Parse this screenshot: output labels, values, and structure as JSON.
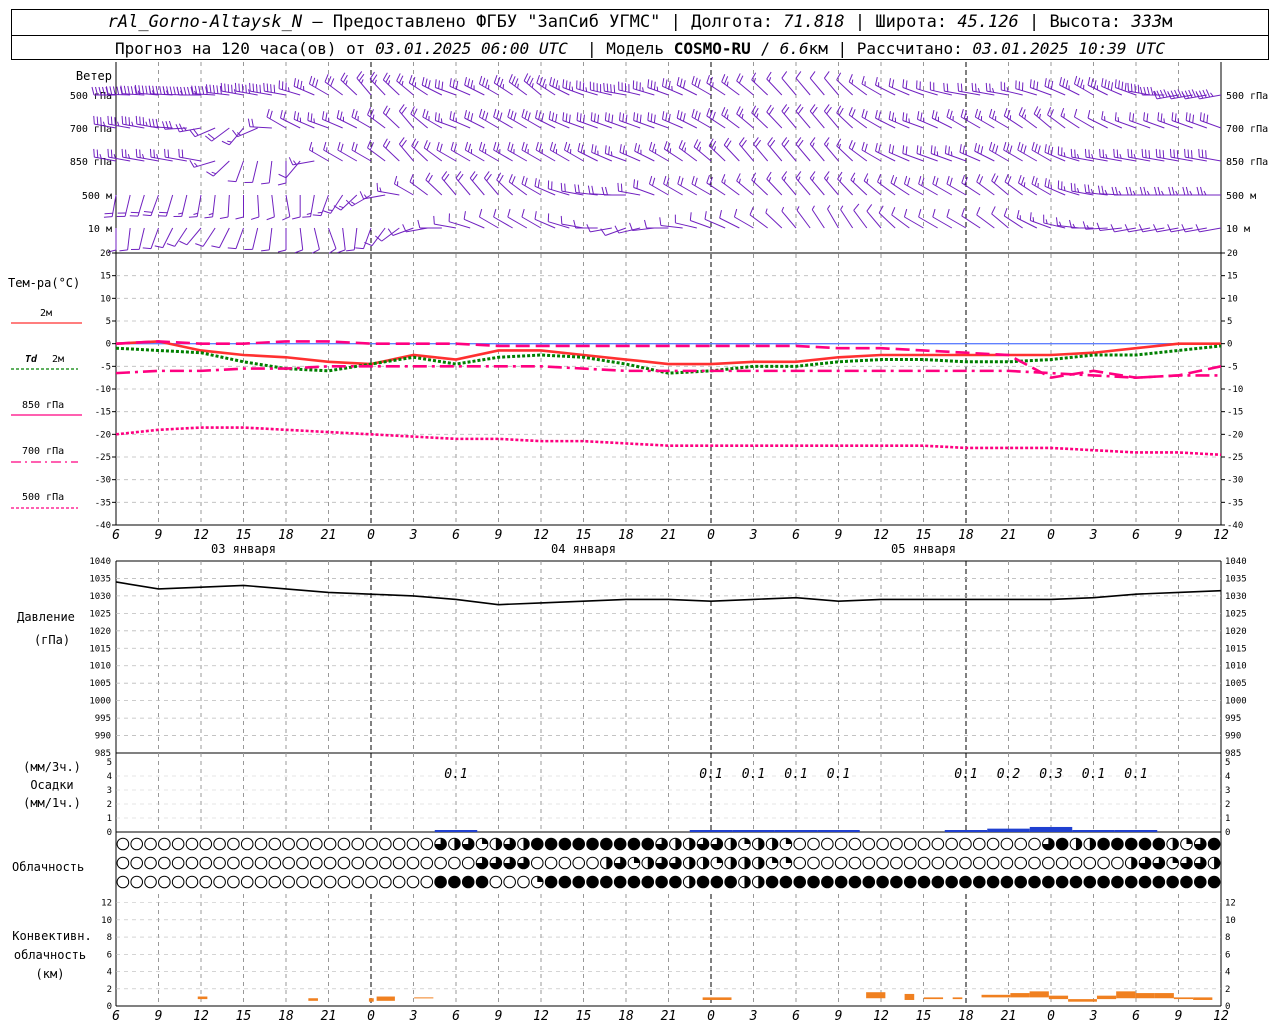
{
  "header": {
    "station": "rAl_Gorno-Altaysk_N",
    "dash": "–",
    "provider": "Предоставлено ФГБУ \"ЗапСиб УГМС\"",
    "lon_label": "Долгота:",
    "lon_value": "71.818",
    "lat_label": "Широта:",
    "lat_value": "45.126",
    "alt_label": "Высота:",
    "alt_value": "333",
    "alt_unit": "м",
    "forecast_prefix": "Прогноз на 120 часа(ов) от",
    "forecast_time": "03.01.2025 06:00 UTC",
    "model_label": "Модель",
    "model_name": "COSMO-RU",
    "model_res": "6.6",
    "model_unit": "км",
    "calc_label": "Рассчитано:",
    "calc_time": "03.01.2025 10:39 UTC",
    "sep": "|"
  },
  "chart_data": [
    {
      "type": "wind-barbs",
      "title": "Ветер",
      "levels": [
        "500 гПа",
        "700 гПа",
        "850 гПа",
        "500 м",
        "10 м"
      ],
      "x_hours": [
        6,
        9,
        12,
        15,
        18,
        21,
        0,
        3,
        6,
        9,
        12,
        15,
        18,
        21,
        0,
        3,
        6,
        9,
        12,
        15,
        18,
        21,
        0,
        3,
        6,
        9,
        12
      ],
      "direction_deg": {
        "500 гПа": [
          270,
          275,
          270,
          280,
          280,
          300,
          320,
          310,
          290,
          300,
          310,
          290,
          280,
          290,
          300,
          310,
          320,
          320,
          300,
          290,
          280,
          280,
          290,
          300,
          290,
          260,
          260
        ],
        "700 гПа": [
          280,
          280,
          260,
          220,
          300,
          290,
          300,
          320,
          290,
          300,
          300,
          290,
          290,
          290,
          300,
          310,
          320,
          320,
          300,
          290,
          300,
          300,
          310,
          300,
          290,
          290,
          290
        ],
        "850 гПа": [
          280,
          280,
          280,
          200,
          180,
          300,
          300,
          320,
          300,
          300,
          300,
          300,
          290,
          300,
          310,
          320,
          320,
          320,
          300,
          290,
          290,
          300,
          300,
          280,
          280,
          280,
          280
        ],
        "500 м": [
          190,
          200,
          190,
          180,
          170,
          200,
          240,
          300,
          320,
          320,
          300,
          280,
          270,
          300,
          300,
          310,
          320,
          320,
          310,
          300,
          300,
          310,
          300,
          280,
          270,
          270,
          270
        ],
        "10 м": [
          180,
          200,
          220,
          200,
          180,
          160,
          200,
          250,
          280,
          300,
          300,
          280,
          250,
          270,
          290,
          300,
          320,
          330,
          320,
          300,
          300,
          310,
          290,
          270,
          260,
          260,
          260
        ]
      },
      "speed_ms": {
        "500 гПа": [
          20,
          22,
          22,
          18,
          16,
          12,
          10,
          10,
          12,
          14,
          14,
          14,
          16,
          14,
          12,
          8,
          4,
          4,
          6,
          8,
          8,
          10,
          12,
          14,
          16,
          18,
          18
        ],
        "700 гПа": [
          14,
          14,
          10,
          6,
          8,
          10,
          10,
          8,
          10,
          12,
          12,
          12,
          12,
          12,
          12,
          10,
          8,
          8,
          8,
          10,
          10,
          10,
          10,
          4,
          6,
          10,
          12
        ],
        "850 гПа": [
          10,
          10,
          8,
          4,
          4,
          6,
          8,
          8,
          8,
          10,
          10,
          10,
          10,
          10,
          10,
          8,
          8,
          6,
          8,
          8,
          10,
          12,
          12,
          10,
          10,
          12,
          12
        ],
        "500 м": [
          8,
          8,
          6,
          4,
          4,
          6,
          6,
          6,
          8,
          8,
          8,
          8,
          8,
          8,
          8,
          6,
          6,
          6,
          6,
          8,
          8,
          8,
          10,
          10,
          10,
          10,
          10
        ],
        "10 м": [
          4,
          4,
          4,
          4,
          4,
          4,
          4,
          4,
          4,
          4,
          4,
          4,
          4,
          4,
          4,
          4,
          2,
          2,
          4,
          4,
          4,
          4,
          6,
          6,
          4,
          4,
          4
        ]
      }
    },
    {
      "type": "line",
      "title": "Тем-ра(°С)",
      "ylim": [
        -40,
        20
      ],
      "ytick_step": 5,
      "x_hours": [
        6,
        9,
        12,
        15,
        18,
        21,
        0,
        3,
        6,
        9,
        12,
        15,
        18,
        21,
        0,
        3,
        6,
        9,
        12,
        15,
        18,
        21,
        0,
        3,
        6,
        9,
        12
      ],
      "series": [
        {
          "name": "2м",
          "color": "#ff3030",
          "style": "solid",
          "values": [
            0,
            0.5,
            -1.5,
            -2.5,
            -3,
            -4,
            -4.5,
            -2.5,
            -3.5,
            -1.5,
            -1.5,
            -2.5,
            -3.5,
            -4.5,
            -4.5,
            -4,
            -4,
            -3,
            -2.5,
            -2.5,
            -2.5,
            -2.5,
            -2.5,
            -2,
            -1,
            0,
            0
          ]
        },
        {
          "name": "Td 2м",
          "color": "#008000",
          "style": "dotted",
          "values": [
            -1,
            -1.5,
            -2,
            -4,
            -5.5,
            -6,
            -4.5,
            -3,
            -4.5,
            -3,
            -2.5,
            -3,
            -4.5,
            -6.5,
            -6,
            -5,
            -5,
            -4,
            -3.5,
            -3.5,
            -4,
            -4,
            -3.5,
            -2.5,
            -2.5,
            -1.5,
            -0.5
          ]
        },
        {
          "name": "850 гПа",
          "color": "#ff0080",
          "style": "longdash",
          "values": [
            0,
            0.5,
            0,
            0,
            0.5,
            0.5,
            0,
            0,
            0,
            -0.5,
            -0.5,
            -0.5,
            -0.5,
            -0.5,
            -0.5,
            -0.5,
            -0.5,
            -1,
            -1,
            -1.5,
            -2,
            -2.5,
            -7.5,
            -6,
            -7.5,
            -7,
            -5
          ]
        },
        {
          "name": "700 гПа",
          "color": "#ff0080",
          "style": "dashdot",
          "values": [
            -6.5,
            -6,
            -6,
            -5.5,
            -5.5,
            -5,
            -5,
            -5,
            -5,
            -5,
            -5,
            -5.5,
            -6,
            -6,
            -6,
            -6,
            -6,
            -6,
            -6,
            -6,
            -6,
            -6,
            -6.5,
            -7,
            -7.5,
            -7,
            -7
          ]
        },
        {
          "name": "500 гПа",
          "color": "#ff0080",
          "style": "shortdash",
          "values": [
            -20,
            -19,
            -18.5,
            -18.5,
            -19,
            -19.5,
            -20,
            -20.5,
            -21,
            -21,
            -21.5,
            -21.5,
            -22,
            -22.5,
            -22.5,
            -22.5,
            -22.5,
            -22.5,
            -22.5,
            -22.5,
            -23,
            -23,
            -23,
            -23.5,
            -24,
            -24,
            -24.5
          ]
        }
      ],
      "x_tick_labels": [
        "6",
        "9",
        "12",
        "15",
        "18",
        "21",
        "0",
        "3",
        "6",
        "9",
        "12",
        "15",
        "18",
        "21",
        "0",
        "3",
        "6",
        "9",
        "12",
        "15",
        "18",
        "21",
        "0",
        "3",
        "6",
        "9",
        "12"
      ],
      "day_labels": [
        "03 января",
        "04 января",
        "05 января"
      ]
    },
    {
      "type": "line",
      "title": "Давление",
      "ylabel": "(гПа)",
      "ylim": [
        985,
        1040
      ],
      "ytick_step": 5,
      "x_hours": [
        6,
        9,
        12,
        15,
        18,
        21,
        0,
        3,
        6,
        9,
        12,
        15,
        18,
        21,
        0,
        3,
        6,
        9,
        12,
        15,
        18,
        21,
        0,
        3,
        6,
        9,
        12
      ],
      "series": [
        {
          "color": "#000000",
          "values": [
            1034,
            1032,
            1032.5,
            1033,
            1032,
            1031,
            1030.5,
            1030,
            1029,
            1027.5,
            1028,
            1028.5,
            1029,
            1029,
            1028.5,
            1029,
            1029.5,
            1028.5,
            1029,
            1029,
            1029,
            1029,
            1029,
            1029.5,
            1030.5,
            1031,
            1031.5
          ]
        }
      ]
    },
    {
      "type": "bar",
      "title": "Осадки",
      "ylabel_top": "(мм/3ч.)",
      "ylabel_bottom": "(мм/1ч.)",
      "ylim": [
        0,
        5
      ],
      "ytick_step": 1,
      "x_hours": [
        6,
        9,
        12,
        15,
        18,
        21,
        0,
        3,
        6,
        9,
        12,
        15,
        18,
        21,
        0,
        3,
        6,
        9,
        12,
        15,
        18,
        21,
        0,
        3,
        6,
        9,
        12
      ],
      "values": [
        0,
        0,
        0,
        0,
        0,
        0,
        0,
        0,
        0.1,
        0,
        0,
        0,
        0,
        0,
        0.1,
        0.1,
        0.1,
        0.1,
        0,
        0,
        0.1,
        0.2,
        0.3,
        0.1,
        0.1,
        0,
        0
      ],
      "labels": [
        {
          "index": 8,
          "text": "0.1"
        },
        {
          "index": 14,
          "text": "0.1"
        },
        {
          "index": 15,
          "text": "0.1"
        },
        {
          "index": 16,
          "text": "0.1"
        },
        {
          "index": 17,
          "text": "0.1"
        },
        {
          "index": 20,
          "text": "0.1"
        },
        {
          "index": 21,
          "text": "0.2"
        },
        {
          "index": 22,
          "text": "0.3"
        },
        {
          "index": 23,
          "text": "0.1"
        },
        {
          "index": 24,
          "text": "0.1"
        }
      ],
      "color": "#2040d0"
    },
    {
      "type": "cloud-cover",
      "title": "Облачность",
      "layers": [
        "верхний",
        "средний",
        "нижний"
      ],
      "symbols_per_row": 80,
      "coverage_fraction": {
        "верхний": "0000000000000000000000000000000000000000000000000000011111111111111111111111111111",
        "средний": "0000000000000000000000000000000000000000000000000000011111111000000000000000001111",
        "нижний": "0000000000000000000000000000000000000000000000001111111111111111111111111111111111"
      },
      "detail": {
        "upper_values": [
          0,
          0,
          0,
          0,
          0,
          0,
          0,
          0,
          0,
          0,
          0,
          0,
          0,
          0,
          0,
          0,
          0,
          0,
          0,
          0,
          0,
          0,
          0,
          0.75,
          0.5,
          0.75,
          0.25,
          0.5,
          0.75,
          0.5,
          1,
          1,
          1,
          1,
          1,
          1,
          1,
          1,
          1,
          0.75,
          0.5,
          0.5,
          0.75,
          0.75,
          0.5,
          0.25,
          0.5,
          0.5,
          0.25,
          0,
          0,
          0,
          0,
          0,
          0,
          0,
          0,
          0,
          0,
          0,
          0,
          0,
          0,
          0,
          0,
          0,
          0,
          0.75,
          1,
          0.5,
          0.5,
          1,
          1,
          1,
          1,
          1,
          0.5,
          0.25,
          0.75,
          1,
          1,
          1,
          1,
          1
        ],
        "middle_values": [
          0,
          0,
          0,
          0,
          0,
          0,
          0,
          0,
          0,
          0,
          0,
          0,
          0,
          0,
          0,
          0,
          0,
          0,
          0,
          0,
          0,
          0,
          0,
          0,
          0,
          0,
          0.75,
          0.75,
          0.75,
          0.75,
          0,
          0,
          0,
          0,
          0,
          0.5,
          0.75,
          0.25,
          0.5,
          0.75,
          0.75,
          0.5,
          0.5,
          0.25,
          0.5,
          0.5,
          0.5,
          0.25,
          0.25,
          0,
          0,
          0,
          0,
          0,
          0,
          0,
          0,
          0,
          0,
          0,
          0,
          0,
          0,
          0,
          0,
          0,
          0,
          0,
          0,
          0,
          0,
          0,
          0,
          0.5,
          0.75,
          0.75,
          0.25,
          0.75,
          0.75,
          0.5,
          0.75,
          0.25,
          0,
          0
        ],
        "lower_values": [
          0,
          0,
          0,
          0,
          0,
          0,
          0,
          0,
          0,
          0,
          0,
          0,
          0,
          0,
          0,
          0,
          0,
          0,
          0,
          0,
          0,
          0,
          0,
          1,
          1,
          1,
          1,
          0,
          0,
          0,
          0.25,
          1,
          1,
          1,
          1,
          1,
          1,
          1,
          1,
          1,
          1,
          0.5,
          1,
          1,
          1,
          0.5,
          0.5,
          1,
          1,
          1,
          1,
          1,
          1,
          1,
          1,
          1,
          1,
          1,
          1,
          1,
          1,
          1,
          1,
          1,
          1,
          1,
          1,
          1,
          1,
          1,
          1,
          1,
          1,
          1,
          1,
          1,
          1,
          1,
          1,
          1,
          1,
          1,
          1,
          0.75
        ]
      }
    },
    {
      "type": "bar",
      "title": "Конвективн. облачность",
      "ylabel": "(км)",
      "ylim": [
        0,
        13
      ],
      "ytick_step": 2,
      "x_hours": [
        6,
        9,
        12,
        15,
        18,
        21,
        0,
        3,
        6,
        9,
        12,
        15,
        18,
        21,
        0,
        3,
        6,
        9,
        12,
        15,
        18,
        21,
        0,
        3,
        6,
        9,
        12
      ],
      "color": "#f08020",
      "segments": [
        {
          "from": 8.5,
          "to": 9.5,
          "top": 1.1,
          "base": 0.8
        },
        {
          "from": 20,
          "to": 21,
          "top": 0.9,
          "base": 0.6
        },
        {
          "from": 26.3,
          "to": 26.8,
          "top": 0.9,
          "base": 0.5
        },
        {
          "from": 27.1,
          "to": 29,
          "top": 1.1,
          "base": 0.6
        },
        {
          "from": 31,
          "to": 33,
          "top": 1.0,
          "base": 0.9
        },
        {
          "from": 61,
          "to": 64,
          "top": 1.0,
          "base": 0.7
        },
        {
          "from": 78,
          "to": 80,
          "top": 1.6,
          "base": 0.9
        },
        {
          "from": 82,
          "to": 83,
          "top": 1.4,
          "base": 0.7
        },
        {
          "from": 84,
          "to": 86,
          "top": 1.0,
          "base": 0.8
        },
        {
          "from": 87,
          "to": 88,
          "top": 1.0,
          "base": 0.8
        },
        {
          "from": 90,
          "to": 93,
          "top": 1.3,
          "base": 1.0
        },
        {
          "from": 93,
          "to": 95,
          "top": 1.5,
          "base": 1.0
        },
        {
          "from": 95,
          "to": 97,
          "top": 1.7,
          "base": 1.0
        },
        {
          "from": 97,
          "to": 99,
          "top": 1.2,
          "base": 0.8
        },
        {
          "from": 99,
          "to": 102,
          "top": 0.8,
          "base": 0.5
        },
        {
          "from": 102,
          "to": 104,
          "top": 1.2,
          "base": 0.8
        },
        {
          "from": 104,
          "to": 106,
          "top": 1.7,
          "base": 0.9
        },
        {
          "from": 106,
          "to": 108,
          "top": 1.5,
          "base": 0.9
        },
        {
          "from": 108,
          "to": 110,
          "top": 1.5,
          "base": 0.9
        },
        {
          "from": 110,
          "to": 112,
          "top": 1.0,
          "base": 0.8
        },
        {
          "from": 112,
          "to": 114,
          "top": 1.0,
          "base": 0.7
        }
      ]
    }
  ],
  "labels": {
    "wind_title": "Ветер",
    "temp_title": "Тем-ра(°С)",
    "legend_2m": "2м",
    "legend_td": "Td",
    "legend_td_2m": "2м",
    "legend_850": "850 гПа",
    "legend_700": "700 гПа",
    "legend_500": "500 гПа",
    "pressure_title": "Давление",
    "pressure_unit": "(гПа)",
    "precip_unit_top": "(мм/3ч.)",
    "precip_title": "Осадки",
    "precip_unit_bottom": "(мм/1ч.)",
    "cloud_title": "Облачность",
    "conv_title_1": "Конвективн.",
    "conv_title_2": "облачность",
    "conv_unit": "(км)"
  }
}
